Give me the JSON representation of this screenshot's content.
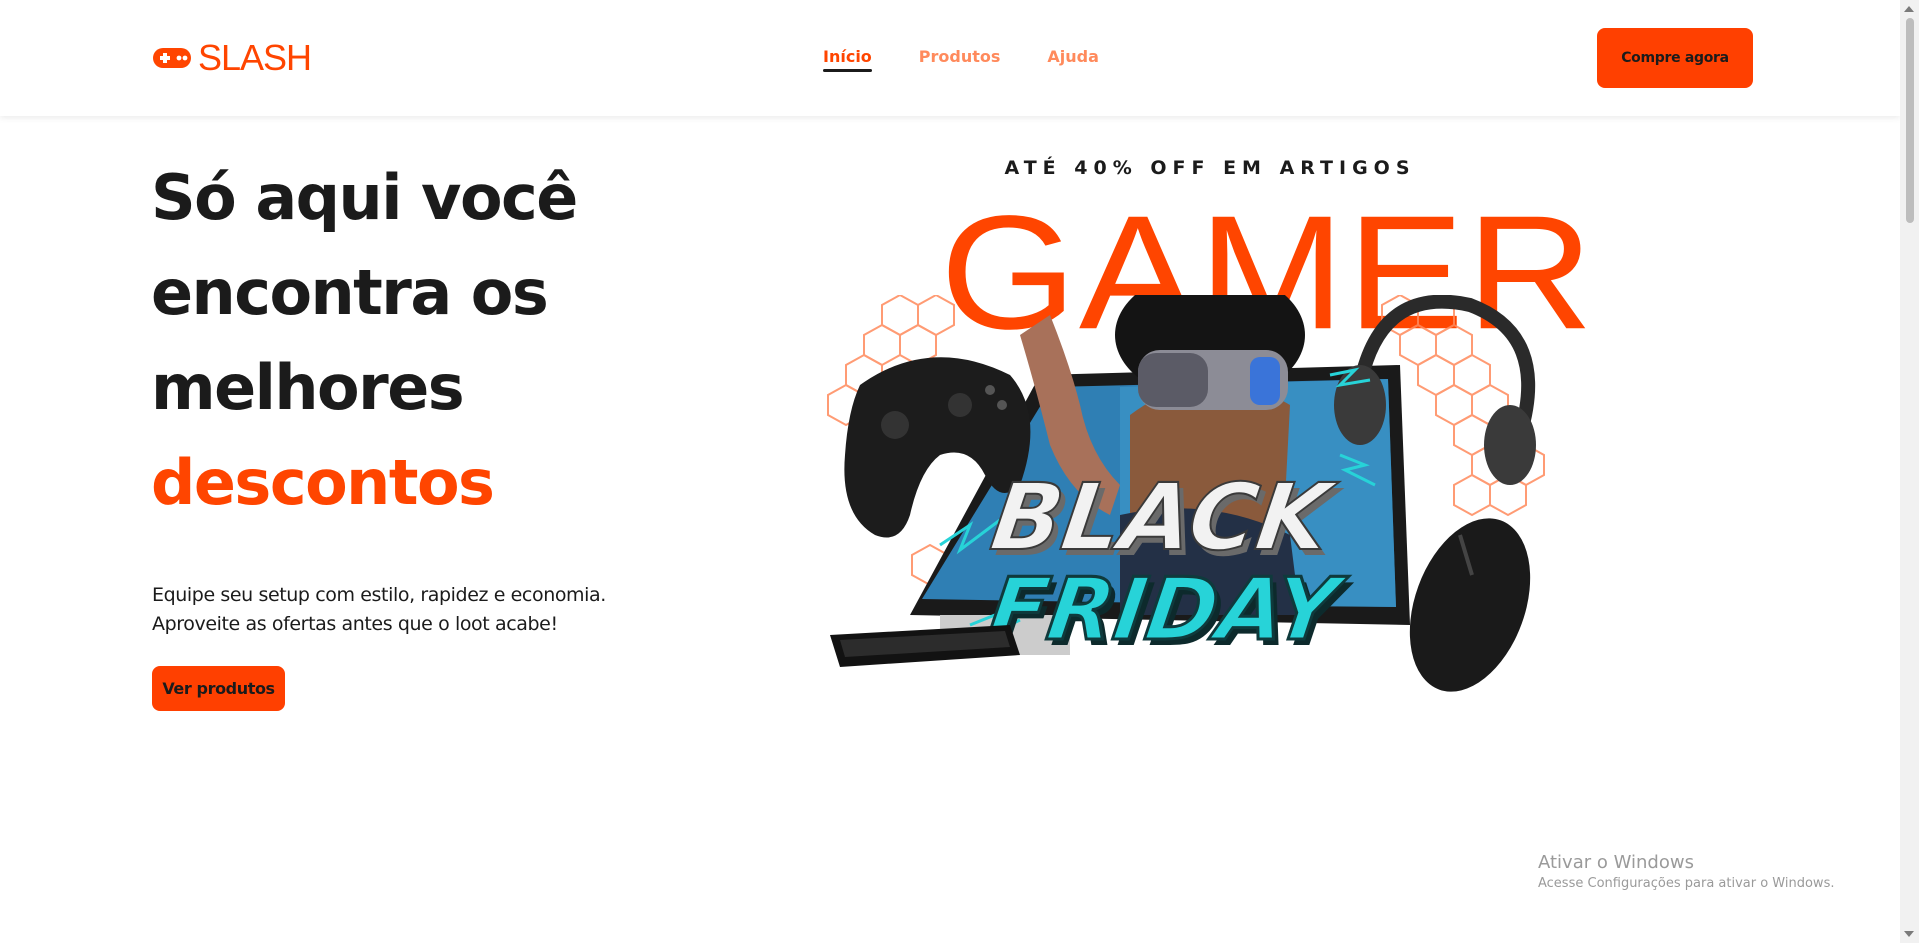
{
  "header": {
    "logo_text": "SLASH",
    "nav": [
      {
        "label": "Início",
        "active": true
      },
      {
        "label": "Produtos",
        "active": false
      },
      {
        "label": "Ajuda",
        "active": false
      }
    ],
    "cta_label": "Compre agora"
  },
  "hero": {
    "title_lines": [
      "Só aqui você",
      "encontra os",
      "melhores"
    ],
    "title_accent": "descontos",
    "description_lines": [
      "Equipe seu setup com estilo, rapidez e economia.",
      "Aproveite as ofertas antes que o loot acabe!"
    ],
    "button_label": "Ver produtos"
  },
  "promo": {
    "tagline": "ATÉ 40% OFF EM ARTIGOS",
    "headline": "GAMER",
    "badge_line1": "BLACK",
    "badge_line2": "FRIDAY"
  },
  "watermark": {
    "title": "Ativar o Windows",
    "subtitle": "Acesse Configurações para ativar o Windows."
  },
  "colors": {
    "brand": "#ff4500",
    "text": "#1b1b1b",
    "nav_inactive": "#ff8a5c",
    "badge_cyan": "#27d3d8"
  },
  "icons": [
    "gamepad-logo-icon",
    "controller-icon",
    "headphones-icon",
    "vr-headset-icon",
    "monitor-icon",
    "keyboard-icon",
    "mouse-icon"
  ]
}
